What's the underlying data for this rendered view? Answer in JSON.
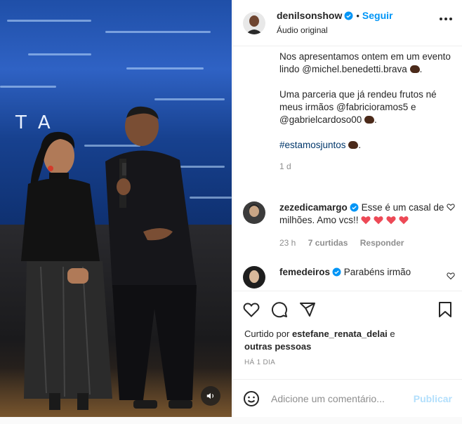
{
  "post": {
    "author": "denilsonshow",
    "follow_label": "Seguir",
    "audio_label": "Áudio original",
    "media_logo_text": "TA"
  },
  "caption": {
    "line1": "Nos apresentamos ontem em um evento lindo @michel.benedetti.brava",
    "line2": "Uma parceria que já rendeu frutos né meus irmãos @fabricioramos5 e @gabrielcardoso00",
    "line3": "#estamosjuntos",
    "time": "1 d"
  },
  "comments": [
    {
      "user": "zezedicamargo",
      "text": "Esse é um casal de milhões. Amo vcs!!",
      "hearts": 4,
      "time": "23 h",
      "likes": "7 curtidas",
      "reply": "Responder"
    },
    {
      "user": "femedeiros",
      "text": "Parabéns irmão"
    }
  ],
  "likes": {
    "prefix": "Curtido por",
    "user": "estefane_renata_delai",
    "connector": "e",
    "others": "outras pessoas"
  },
  "posted_ago": "HÁ 1 DIA",
  "composer": {
    "placeholder": "Adicione um comentário...",
    "publish": "Publicar"
  },
  "colors": {
    "accent": "#0095f6",
    "publish_disabled": "#b2dffc",
    "heart_red": "#ed4956",
    "muted": "#8e8e8e"
  },
  "icons": [
    "verified-icon",
    "more-icon",
    "heart-icon",
    "comment-icon",
    "share-icon",
    "bookmark-icon",
    "emoji-icon",
    "sound-icon"
  ]
}
